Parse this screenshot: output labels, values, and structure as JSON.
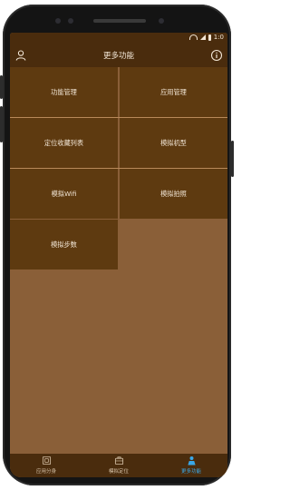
{
  "status_bar": {
    "battery_text": "1:0"
  },
  "header": {
    "title": "更多功能"
  },
  "menu": {
    "items": [
      {
        "label": "功能管理"
      },
      {
        "label": "应用管理"
      },
      {
        "label": "定位收藏列表"
      },
      {
        "label": "模拟机型"
      },
      {
        "label": "模拟Wifi"
      },
      {
        "label": "模拟拍照"
      },
      {
        "label": "模拟步数"
      }
    ]
  },
  "tabs": [
    {
      "label": "应用分身",
      "icon": "app-clone-icon",
      "active": false
    },
    {
      "label": "模拟定位",
      "icon": "briefcase-icon",
      "active": false
    },
    {
      "label": "更多功能",
      "icon": "person-more-icon",
      "active": true
    }
  ],
  "colors": {
    "header_bg": "#4a2c0d",
    "cell_bg": "#5e3a10",
    "page_bg": "#8a5f38",
    "active_tab": "#3aa8e8",
    "text": "#f2e6d6"
  }
}
